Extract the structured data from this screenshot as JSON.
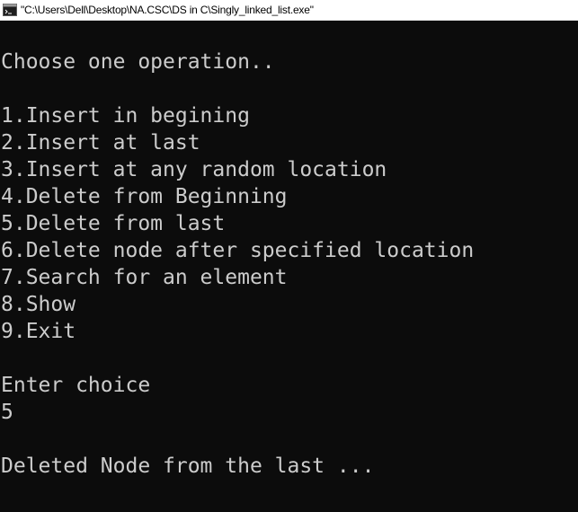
{
  "window": {
    "title": "\"C:\\Users\\Dell\\Desktop\\NA.CSC\\DS in C\\Singly_linked_list.exe\"",
    "icon": "console-app-icon",
    "colors": {
      "background": "#0c0c0c",
      "foreground": "#cccccc",
      "titlebar": "#ffffff"
    }
  },
  "console": {
    "prompt_header": "Choose one operation..",
    "menu": [
      "1.Insert in begining",
      "2.Insert at last",
      "3.Insert at any random location",
      "4.Delete from Beginning",
      "5.Delete from last",
      "6.Delete node after specified location",
      "7.Search for an element",
      "8.Show",
      "9.Exit"
    ],
    "choice_prompt": "Enter choice",
    "choice_input": "5",
    "result": "Deleted Node from the last ..."
  }
}
